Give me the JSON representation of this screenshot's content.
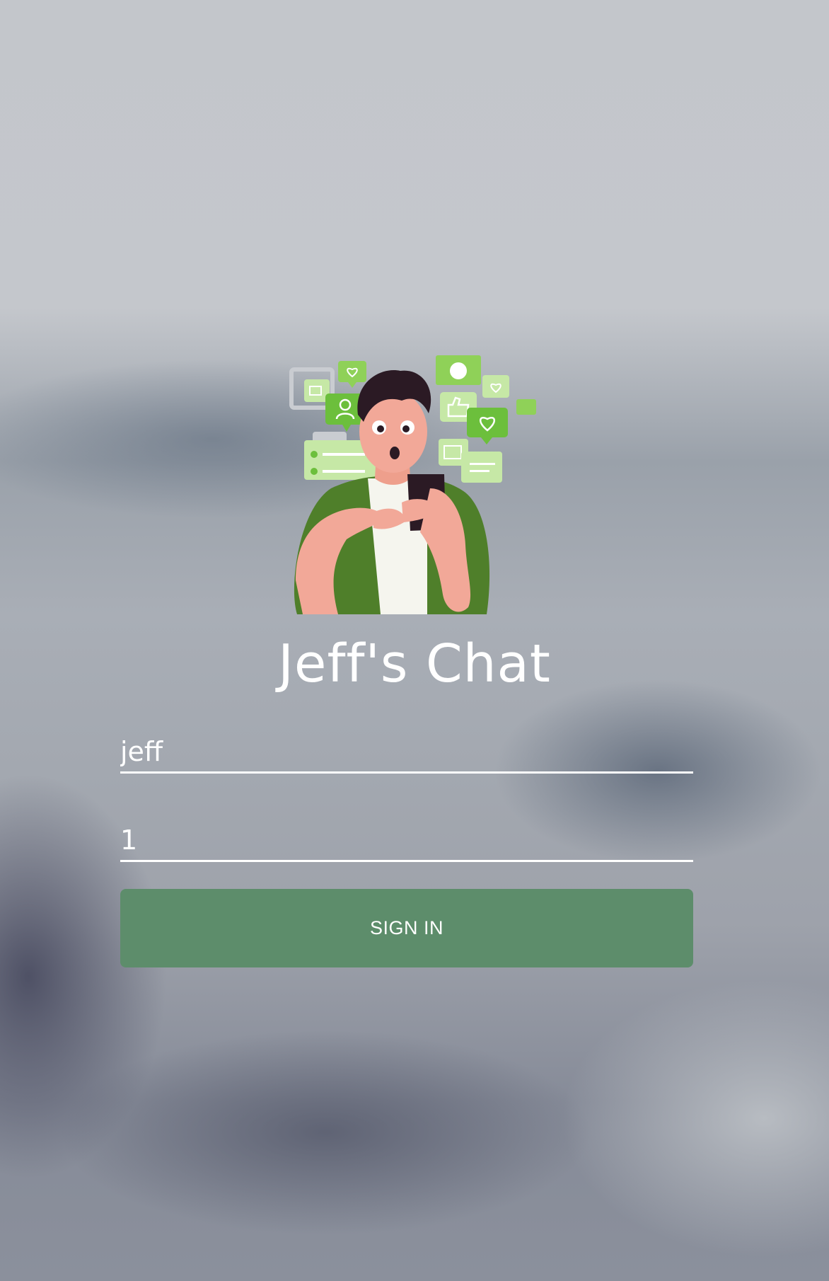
{
  "app": {
    "title": "Jeff's Chat"
  },
  "illustration": {
    "icon": "person-with-phone-chat-illustration",
    "accent_green": "#4f7f2a",
    "bubble_green": "#8fd158",
    "light_green": "#c6e8a6"
  },
  "form": {
    "username_value": "jeff",
    "password_value": "1",
    "signin_label": "SIGN IN",
    "button_color": "#5d8d6b"
  }
}
